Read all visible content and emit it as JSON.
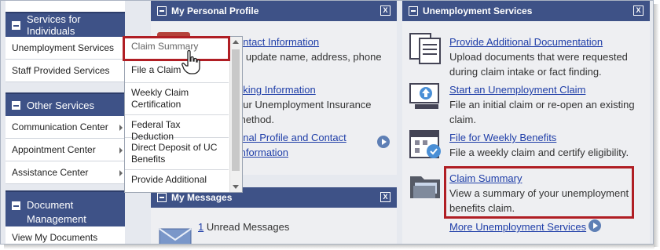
{
  "left_nav": {
    "individuals": {
      "header": "Services for Individuals",
      "items": [
        "Unemployment Services",
        "Staff Provided Services"
      ]
    },
    "other": {
      "header": "Other Services",
      "items": [
        "Communication Center",
        "Appointment Center",
        "Assistance Center"
      ]
    },
    "documents": {
      "header": "Document Management",
      "items": [
        "View My Documents"
      ]
    }
  },
  "dropdown": {
    "items": [
      "Claim Summary",
      "File a Claim",
      "Weekly Claim Certification",
      "Federal Tax Deduction",
      "Direct Deposit of UC Benefits",
      "Provide Additional"
    ]
  },
  "profile_panel": {
    "title": "My Personal Profile",
    "close": "X",
    "contact_link": "ontact Information",
    "contact_desc_1": "d update name, address, phone",
    "banking_link": "nking Information",
    "banking_desc_1": "our Unemployment Insurance",
    "banking_desc_2": "method.",
    "personal_link_1": "onal Profile and Contact",
    "personal_link_2": "Information"
  },
  "messages_panel": {
    "title": "My Messages",
    "close": "X",
    "unread_count": "1",
    "unread_label": " Unread Messages"
  },
  "unemployment_panel": {
    "title": "Unemployment Services",
    "close": "X",
    "items": [
      {
        "link": "Provide Additional Documentation",
        "desc": "Upload documents that were requested during claim intake or fact finding.",
        "icon": "documents-icon"
      },
      {
        "link": "Start an Unemployment Claim",
        "desc": "File an initial claim or re-open an existing claim.",
        "icon": "computer-upload-icon"
      },
      {
        "link": "File for Weekly Benefits",
        "desc": "File a weekly claim and certify eligibility.",
        "icon": "calendar-icon"
      },
      {
        "link": "Claim Summary",
        "desc": "View a summary of your unemployment benefits claim.",
        "icon": "folder-icon"
      }
    ],
    "more_link": "More Unemployment Services"
  },
  "colors": {
    "header_blue": "#3e5287",
    "link_blue": "#1f3ea8",
    "highlight_red": "#b01e24"
  }
}
